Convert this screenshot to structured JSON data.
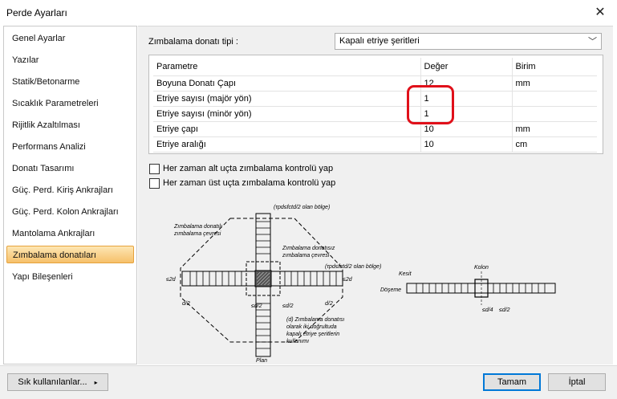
{
  "window": {
    "title": "Perde Ayarları",
    "close_icon": "close-icon"
  },
  "sidebar": {
    "items": [
      {
        "label": "Genel Ayarlar"
      },
      {
        "label": "Yazılar"
      },
      {
        "label": "Statik/Betonarme"
      },
      {
        "label": "Sıcaklık Parametreleri"
      },
      {
        "label": "Rijitlik Azaltılması"
      },
      {
        "label": "Performans Analizi"
      },
      {
        "label": "Donatı Tasarımı"
      },
      {
        "label": "Güç. Perd. Kiriş Ankrajları"
      },
      {
        "label": "Güç. Perd. Kolon Ankrajları"
      },
      {
        "label": "Mantolama Ankrajları"
      },
      {
        "label": "Zımbalama donatıları"
      },
      {
        "label": "Yapı Bileşenleri"
      }
    ],
    "selected_index": 10
  },
  "content": {
    "type_label": "Zımbalama donatı tipi :",
    "type_value": "Kapalı etriye şeritleri",
    "table": {
      "headers": [
        "Parametre",
        "Değer",
        "Birim"
      ],
      "rows": [
        {
          "param": "Boyuna Donatı Çapı",
          "value": "12",
          "unit": "mm"
        },
        {
          "param": "Etriye sayısı (majör yön)",
          "value": "1",
          "unit": ""
        },
        {
          "param": "Etriye sayısı (minör yön)",
          "value": "1",
          "unit": ""
        },
        {
          "param": "Etriye çapı",
          "value": "10",
          "unit": "mm"
        },
        {
          "param": "Etriye aralığı",
          "value": "10",
          "unit": "cm"
        }
      ]
    },
    "check_bottom": {
      "label": "Her zaman alt uçta zımbalama kontrolü yap",
      "checked": false
    },
    "check_top": {
      "label": "Her zaman üst uçta zımbalama kontrolü yap",
      "checked": false
    },
    "diagram": {
      "label_top_zone": "(τpd≤fctd/2 olan bölge)",
      "label_with_rebar": "Zımbalama donatılı",
      "label_with_rebar_2": "zımbalama çevresi",
      "label_without_rebar": "Zımbalama donatısız",
      "label_without_rebar_2": "zımbalama çevresi",
      "label_side_zone": "(τpd≤fctd/2 olan bölge)",
      "dim_2d": "≤2d",
      "dim_2d_right": "≤2d",
      "dim_d2_a": "d/2",
      "dim_d2_b": "≤d/2",
      "dim_d2_c": "≤d/2",
      "dim_d2_d": "d/2",
      "note_1": "(d) Zımbalama donatısı",
      "note_2": "olarak iki doğrultuda",
      "note_3": "kapalı etriye şeritlerin",
      "note_4": "kullanımı",
      "plan": "Plan",
      "kesit": "Kesit",
      "kolon": "Kolon",
      "doseme": "Döşeme",
      "dim_d4": "≤d/4",
      "dim_d2_e": "≤d/2"
    }
  },
  "footer": {
    "frequent_label": "Sık kullanılanlar...",
    "ok_label": "Tamam",
    "cancel_label": "İptal"
  },
  "colors": {
    "highlight": "#e0101a",
    "selected_item": "#f6c06a"
  }
}
